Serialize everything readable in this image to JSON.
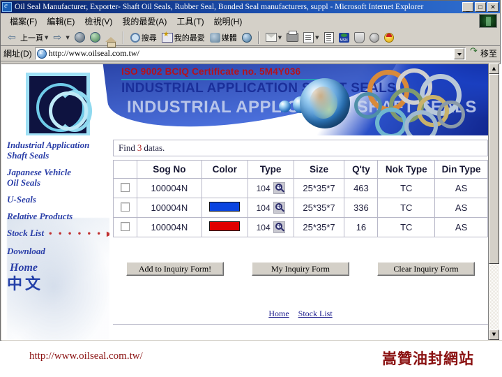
{
  "window": {
    "title": "Oil Seal Manufacturer, Exporter- Shaft Oil Seals, Rubber Seal, Bonded Seal manufacturers, suppl - Microsoft Internet Explorer",
    "minimize_label": "_",
    "maximize_label": "□",
    "close_label": "✕"
  },
  "menu": {
    "items": [
      {
        "label": "檔案(F)"
      },
      {
        "label": "編輯(E)"
      },
      {
        "label": "檢視(V)"
      },
      {
        "label": "我的最愛(A)"
      },
      {
        "label": "工具(T)"
      },
      {
        "label": "說明(H)"
      }
    ]
  },
  "toolbar": {
    "back_label": "上一頁",
    "search_label": "搜尋",
    "favorites_label": "我的最愛",
    "media_label": "媒體"
  },
  "address": {
    "label": "網址(D)",
    "url": "http://www.oilseal.com.tw/",
    "go_label": "移至"
  },
  "banner": {
    "iso_text": "ISO 9002 BCIQ Certificate no. 5M4Y036",
    "title": "INDUSTRIAL APPLICATION SHAFT SEALS",
    "ghost_title": "INDUSTRIAL APPLICATION SHAFT SEALS"
  },
  "sidebar": {
    "items": [
      {
        "label_line1": "Industrial Application",
        "label_line2": "Shaft Seals"
      },
      {
        "label_line1": "Japanese Vehicle",
        "label_line2": "Oil Seals"
      },
      {
        "label_line1": "U-Seals",
        "label_line2": ""
      },
      {
        "label_line1": "Relative Products",
        "label_line2": ""
      },
      {
        "label_line1": "Stock List",
        "label_line2": ""
      },
      {
        "label_line1": "Download",
        "label_line2": ""
      },
      {
        "label_line1": "Home",
        "label_line2": ""
      },
      {
        "label_line1": "中文",
        "label_line2": ""
      }
    ],
    "stock_dots": "• • • • • •",
    "stock_arrow": "▶"
  },
  "main": {
    "find_prefix": "Find",
    "find_count": "3",
    "find_suffix": "datas.",
    "table": {
      "headers": [
        "",
        "Sog No",
        "Color",
        "Type",
        "Size",
        "Q'ty",
        "Nok Type",
        "Din Type"
      ],
      "rows": [
        {
          "checked": false,
          "sog_no": "100004N",
          "color_hex": "",
          "type": "104",
          "size": "25*35*7",
          "qty": "463",
          "nok_type": "TC",
          "din_type": "AS"
        },
        {
          "checked": false,
          "sog_no": "100004N",
          "color_hex": "#0a44e0",
          "type": "104",
          "size": "25*35*7",
          "qty": "336",
          "nok_type": "TC",
          "din_type": "AS"
        },
        {
          "checked": false,
          "sog_no": "100004N",
          "color_hex": "#e00000",
          "type": "104",
          "size": "25*35*7",
          "qty": "16",
          "nok_type": "TC",
          "din_type": "AS"
        }
      ]
    },
    "buttons": {
      "add": "Add to Inquiry Form!",
      "my": "My Inquiry Form",
      "clear": "Clear Inquiry Form"
    },
    "footer_links": [
      {
        "label": "Home"
      },
      {
        "label": "Stock List"
      }
    ]
  },
  "bottom": {
    "url": "http://www.oilseal.com.tw/",
    "chinese": "嵩贊油封網站"
  },
  "colors": {
    "titlebar_blue": "#0a246a",
    "chrome_gray": "#d4d0c8",
    "link_blue": "#2b3fa8",
    "brand_red": "#8a1111",
    "iso_red": "#b6121b",
    "banner_blue": "#1a2f9a"
  }
}
